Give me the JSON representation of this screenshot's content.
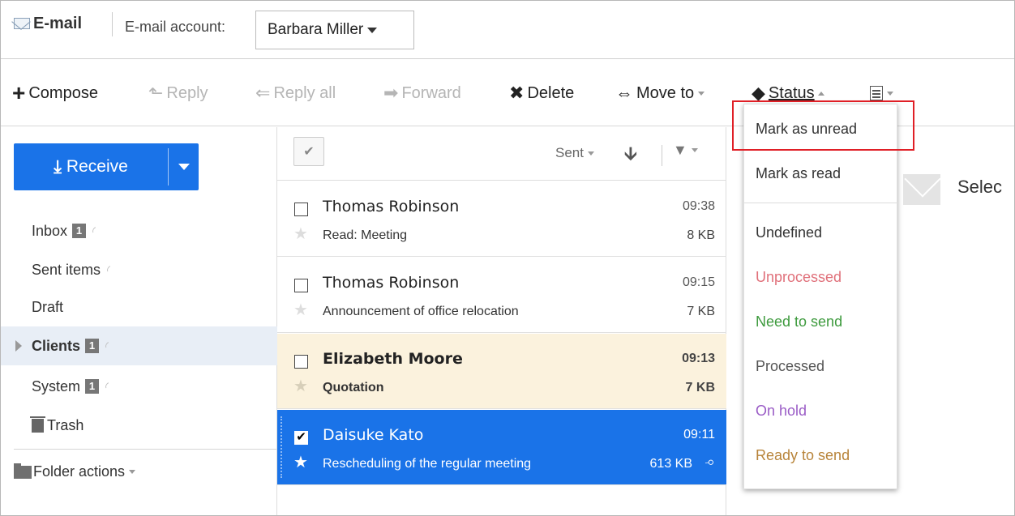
{
  "header": {
    "app_title": "E-mail",
    "account_label": "E-mail account:",
    "account_value": "Barbara Miller"
  },
  "toolbar": {
    "compose": "Compose",
    "reply": "Reply",
    "reply_all": "Reply all",
    "forward": "Forward",
    "delete": "Delete",
    "move_to": "Move to",
    "status": "Status"
  },
  "sidebar": {
    "receive_label": "Receive",
    "folders": [
      {
        "label": "Inbox",
        "badge": "1"
      },
      {
        "label": "Sent items",
        "badge": ""
      },
      {
        "label": "Draft",
        "badge": ""
      },
      {
        "label": "Clients",
        "badge": "1"
      },
      {
        "label": "System",
        "badge": "1"
      },
      {
        "label": "Trash",
        "badge": ""
      }
    ],
    "folder_actions": "Folder actions"
  },
  "list": {
    "sort_label": "Sent",
    "messages": [
      {
        "sender": "Thomas Robinson",
        "time": "09:38",
        "subject": "Read: Meeting",
        "size": "8 KB"
      },
      {
        "sender": "Thomas Robinson",
        "time": "09:15",
        "subject": "Announcement of office relocation",
        "size": "7 KB"
      },
      {
        "sender": "Elizabeth Moore",
        "time": "09:13",
        "subject": "Quotation",
        "size": "7 KB"
      },
      {
        "sender": "Daisuke Kato",
        "time": "09:11",
        "subject": "Rescheduling of the regular meeting",
        "size": "613 KB"
      }
    ]
  },
  "preview": {
    "text": "Selec"
  },
  "status_menu": {
    "items": [
      {
        "label": "Mark as unread",
        "color": "#333333"
      },
      {
        "label": "Mark as read",
        "color": "#333333"
      },
      {
        "label": "Undefined",
        "color": "#333333"
      },
      {
        "label": "Unprocessed",
        "color": "#e0707a"
      },
      {
        "label": "Need to send",
        "color": "#3d9a3d"
      },
      {
        "label": "Processed",
        "color": "#555555"
      },
      {
        "label": "On hold",
        "color": "#9a5cc6"
      },
      {
        "label": "Ready to send",
        "color": "#b8843a"
      }
    ]
  },
  "colors": {
    "accent": "#1a73e8",
    "highlight_box": "#e01f26",
    "unread_row": "#fbf2dd"
  }
}
